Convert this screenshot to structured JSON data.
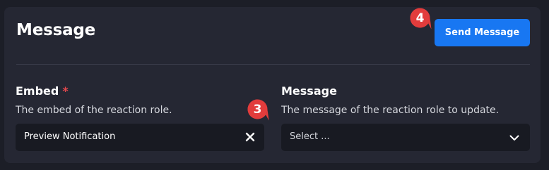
{
  "title": "Message",
  "send_button": {
    "label": "Send Message"
  },
  "embed_field": {
    "label": "Embed",
    "required_mark": "*",
    "description": "The embed of the reaction role.",
    "value": "Preview Notification"
  },
  "message_field": {
    "label": "Message",
    "description": "The message of the reaction role to update.",
    "placeholder": "Select ..."
  },
  "markers": {
    "send": "4",
    "clear": "3"
  },
  "colors": {
    "page_bg": "#1c1e27",
    "panel_bg": "#252733",
    "input_bg": "#181a22",
    "accent": "#1877f2",
    "required": "#e5484d",
    "marker": "#e23c3c"
  },
  "icons": {
    "clear": "close-icon",
    "select": "chevron-down-icon"
  }
}
